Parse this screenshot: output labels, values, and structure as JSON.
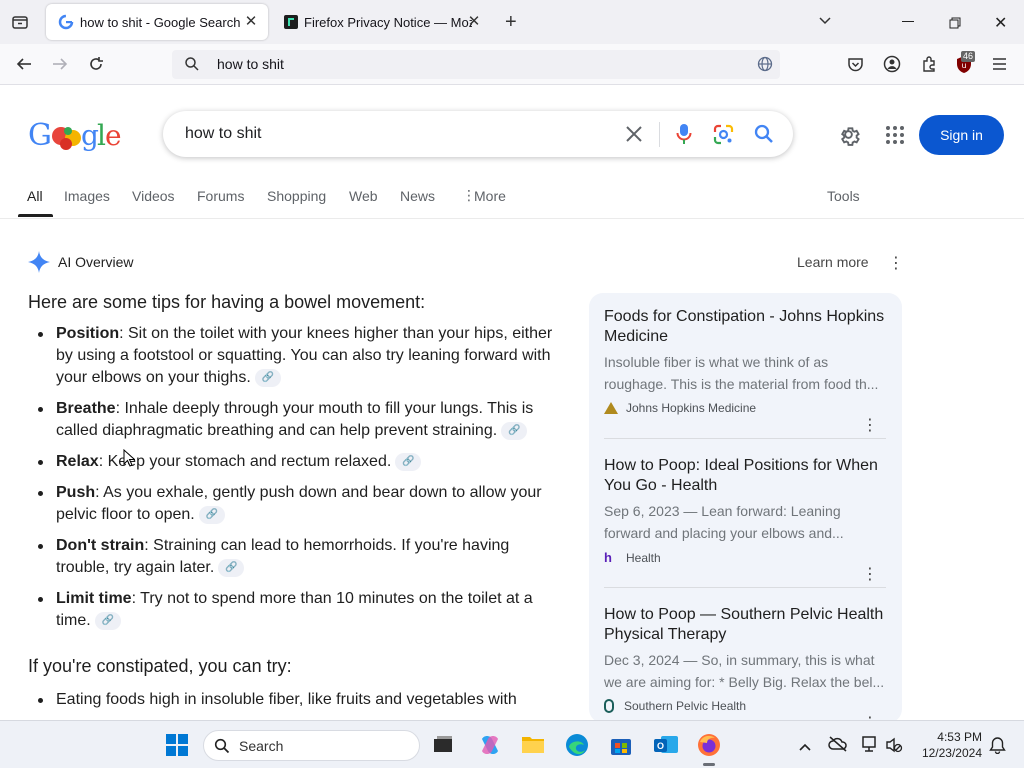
{
  "browser": {
    "tabs": [
      {
        "title": "how to shit - Google Search",
        "active": true
      },
      {
        "title": "Firefox Privacy Notice — Mozill",
        "active": false
      }
    ],
    "url": "how to shit",
    "extension_badge": "46"
  },
  "google": {
    "query": "how to shit",
    "signin_label": "Sign in",
    "tabs": [
      "All",
      "Images",
      "Videos",
      "Forums",
      "Shopping",
      "Web",
      "News",
      "More"
    ],
    "tools_label": "Tools",
    "ai_overview": {
      "title": "AI Overview",
      "learn_more": "Learn more",
      "intro": "Here are some tips for having a bowel movement:",
      "tips": [
        {
          "bold": "Position",
          "text": ": Sit on the toilet with your knees higher than your hips, either by using a footstool or squatting. You can also try leaning forward with your elbows on your thighs."
        },
        {
          "bold": "Breathe",
          "text": ": Inhale deeply through your mouth to fill your lungs. This is called diaphragmatic breathing and can help prevent straining."
        },
        {
          "bold": "Relax",
          "text": ": Keep your stomach and rectum relaxed."
        },
        {
          "bold": "Push",
          "text": ": As you exhale, gently push down and bear down to allow your pelvic floor to open."
        },
        {
          "bold": "Don't strain",
          "text": ": Straining can lead to hemorrhoids. If you're having trouble, try again later."
        },
        {
          "bold": "Limit time",
          "text": ": Try not to spend more than 10 minutes on the toilet at a time."
        }
      ],
      "constipated_heading": "If you're constipated, you can try:",
      "constipated_first": "Eating foods high in insoluble fiber, like fruits and vegetables with"
    },
    "sources": [
      {
        "title": "Foods for Constipation - Johns Hopkins Medicine",
        "snippet": "Insoluble fiber is what we think of as roughage. This is the material from food th...",
        "site": "Johns Hopkins Medicine"
      },
      {
        "title": "How to Poop: Ideal Positions for When You Go - Health",
        "snippet": "Sep 6, 2023 — Lean forward: Leaning forward and placing your elbows and...",
        "site": "Health"
      },
      {
        "title": "How to Poop — Southern Pelvic Health Physical Therapy",
        "snippet": "Dec 3, 2024 — So, in summary, this is what we are aiming for: * Belly Big. Relax the bel...",
        "site": "Southern Pelvic Health"
      }
    ]
  },
  "taskbar": {
    "search_label": "Search",
    "time": "4:53 PM",
    "date": "12/23/2024"
  }
}
